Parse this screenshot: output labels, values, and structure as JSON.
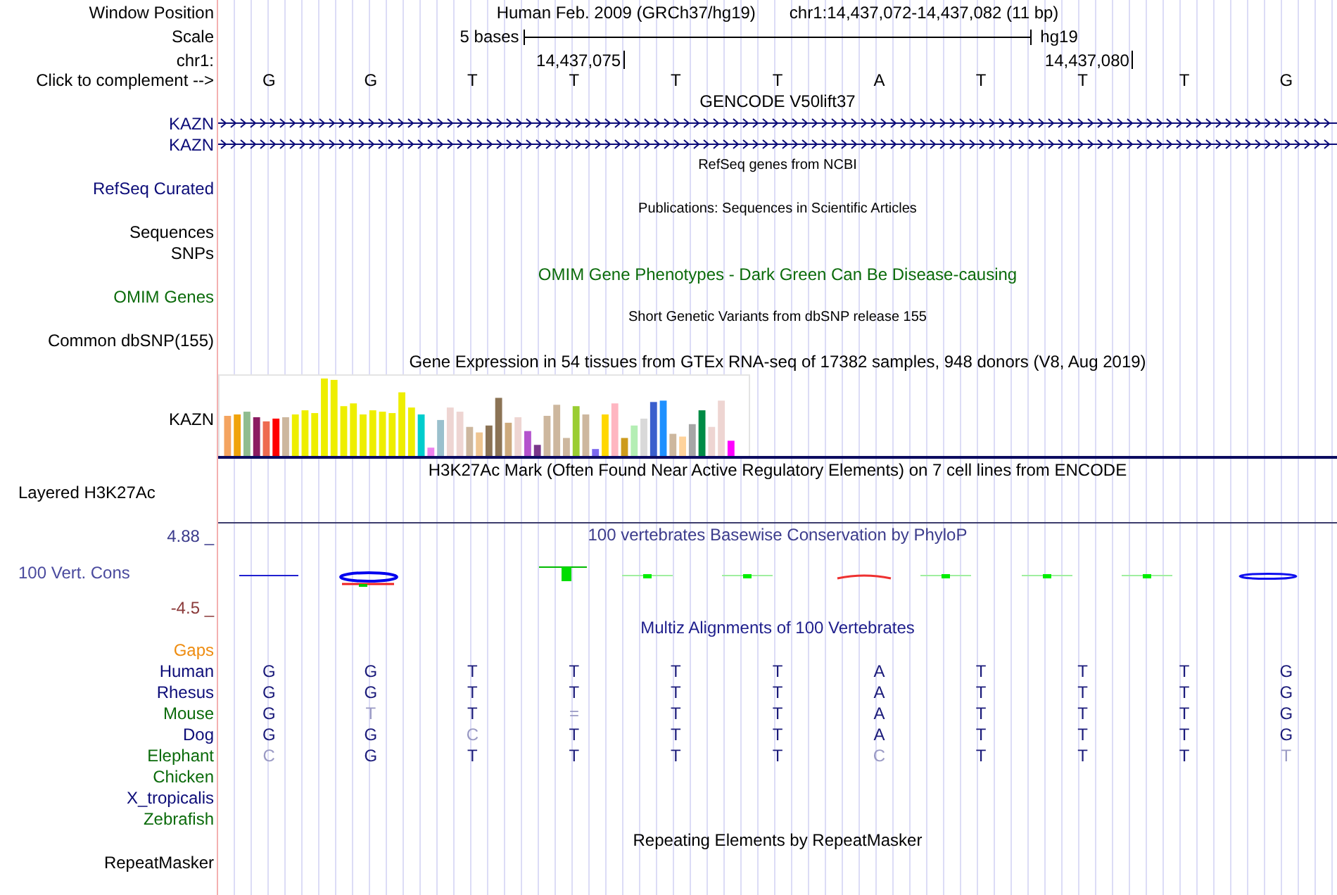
{
  "position": {
    "label": "Window Position",
    "assembly": "Human Feb. 2009 (GRCh37/hg19)",
    "range": "chr1:14,437,072-14,437,082 (11 bp)"
  },
  "scale": {
    "label": "Scale",
    "span": "5 bases",
    "assembly": "hg19"
  },
  "ruler": {
    "label": "chr1:",
    "ticks": [
      "14,437,075",
      "14,437,080"
    ]
  },
  "bases": {
    "label": "Click to complement -->",
    "letters": [
      "G",
      "G",
      "T",
      "T",
      "T",
      "T",
      "A",
      "T",
      "T",
      "T",
      "G"
    ]
  },
  "tracks": [
    {
      "kind": "title",
      "text": "GENCODE V50lift37",
      "color": "#000000"
    },
    {
      "kind": "gene",
      "label": "KAZN",
      "color": "#0c0c78"
    },
    {
      "kind": "gene",
      "label": "KAZN",
      "color": "#0c0c78"
    },
    {
      "kind": "title_small",
      "text": "RefSeq genes from NCBI",
      "color": "#000000"
    },
    {
      "kind": "label",
      "label": "RefSeq Curated",
      "color": "#0c0c78"
    },
    {
      "kind": "title_small",
      "text": "Publications: Sequences in Scientific Articles",
      "color": "#000000"
    },
    {
      "kind": "label",
      "label": "Sequences",
      "color": "#000000"
    },
    {
      "kind": "label",
      "label": "SNPs",
      "color": "#000000"
    },
    {
      "kind": "title",
      "text": "OMIM Gene Phenotypes - Dark Green Can Be Disease-causing",
      "color": "#0b6b0b"
    },
    {
      "kind": "label",
      "label": "OMIM Genes",
      "color": "#0b6b0b"
    },
    {
      "kind": "title_small",
      "text": "Short Genetic Variants from dbSNP release 155",
      "color": "#000000"
    },
    {
      "kind": "label",
      "label": "Common dbSNP(155)",
      "color": "#000000"
    },
    {
      "kind": "title",
      "text": "Gene Expression in 54 tissues from GTEx RNA-seq of 17382 samples, 948 donors (V8, Aug 2019)",
      "color": "#000000"
    },
    {
      "kind": "bars",
      "label": "KAZN",
      "color": "#000000"
    },
    {
      "kind": "title",
      "text": "H3K27Ac Mark (Often Found Near Active Regulatory Elements) on 7 cell lines from ENCODE",
      "color": "#000000"
    },
    {
      "kind": "label_left",
      "label": "Layered H3K27Ac",
      "color": "#000000"
    },
    {
      "kind": "cons",
      "title": "100 vertebrates Basewise Conservation by PhyloP",
      "max": "4.88 _",
      "label": "100 Vert. Cons",
      "min": "-4.5 _",
      "color": "#3c3c8c"
    },
    {
      "kind": "title",
      "text": "Multiz Alignments of 100 Vertebrates",
      "color": "#1e1e8c"
    },
    {
      "kind": "label",
      "label": "Gaps",
      "color": "#ee8c10"
    },
    {
      "kind": "align",
      "label": "Human",
      "color": "#0c0c78",
      "bases": [
        {
          "base": "G",
          "match": true
        },
        {
          "base": "G",
          "match": true
        },
        {
          "base": "T",
          "match": true
        },
        {
          "base": "T",
          "match": true
        },
        {
          "base": "T",
          "match": true
        },
        {
          "base": "T",
          "match": true
        },
        {
          "base": "A",
          "match": true
        },
        {
          "base": "T",
          "match": true
        },
        {
          "base": "T",
          "match": true
        },
        {
          "base": "T",
          "match": true
        },
        {
          "base": "G",
          "match": true
        }
      ]
    },
    {
      "kind": "align",
      "label": "Rhesus",
      "color": "#0c0c78",
      "bases": [
        {
          "base": "G",
          "match": true
        },
        {
          "base": "G",
          "match": true
        },
        {
          "base": "T",
          "match": true
        },
        {
          "base": "T",
          "match": true
        },
        {
          "base": "T",
          "match": true
        },
        {
          "base": "T",
          "match": true
        },
        {
          "base": "A",
          "match": true
        },
        {
          "base": "T",
          "match": true
        },
        {
          "base": "T",
          "match": true
        },
        {
          "base": "T",
          "match": true
        },
        {
          "base": "G",
          "match": true
        }
      ]
    },
    {
      "kind": "align",
      "label": "Mouse",
      "color": "#0b6b0b",
      "bases": [
        {
          "base": "G",
          "match": true
        },
        {
          "base": "T",
          "match": false
        },
        {
          "base": "T",
          "match": true
        },
        {
          "base": "=",
          "match": false
        },
        {
          "base": "T",
          "match": true
        },
        {
          "base": "T",
          "match": true
        },
        {
          "base": "A",
          "match": true
        },
        {
          "base": "T",
          "match": true
        },
        {
          "base": "T",
          "match": true
        },
        {
          "base": "T",
          "match": true
        },
        {
          "base": "G",
          "match": true
        }
      ]
    },
    {
      "kind": "align",
      "label": "Dog",
      "color": "#0c0c78",
      "bases": [
        {
          "base": "G",
          "match": true
        },
        {
          "base": "G",
          "match": true
        },
        {
          "base": "C",
          "match": false
        },
        {
          "base": "T",
          "match": true
        },
        {
          "base": "T",
          "match": true
        },
        {
          "base": "T",
          "match": true
        },
        {
          "base": "A",
          "match": true
        },
        {
          "base": "T",
          "match": true
        },
        {
          "base": "T",
          "match": true
        },
        {
          "base": "T",
          "match": true
        },
        {
          "base": "G",
          "match": true
        }
      ]
    },
    {
      "kind": "align",
      "label": "Elephant",
      "color": "#0b6b0b",
      "bases": [
        {
          "base": "C",
          "match": false
        },
        {
          "base": "G",
          "match": true
        },
        {
          "base": "T",
          "match": true
        },
        {
          "base": "T",
          "match": true
        },
        {
          "base": "T",
          "match": true
        },
        {
          "base": "T",
          "match": true
        },
        {
          "base": "C",
          "match": false
        },
        {
          "base": "T",
          "match": true
        },
        {
          "base": "T",
          "match": true
        },
        {
          "base": "T",
          "match": true
        },
        {
          "base": "T",
          "match": false
        }
      ]
    },
    {
      "kind": "align",
      "label": "Chicken",
      "color": "#0b6b0b"
    },
    {
      "kind": "align",
      "label": "X_tropicalis",
      "color": "#0c0c78"
    },
    {
      "kind": "align",
      "label": "Zebrafish",
      "color": "#0b6b0b"
    },
    {
      "kind": "title",
      "text": "Repeating Elements by RepeatMasker",
      "color": "#000000"
    },
    {
      "kind": "label",
      "label": "RepeatMasker",
      "color": "#000000"
    }
  ]
}
